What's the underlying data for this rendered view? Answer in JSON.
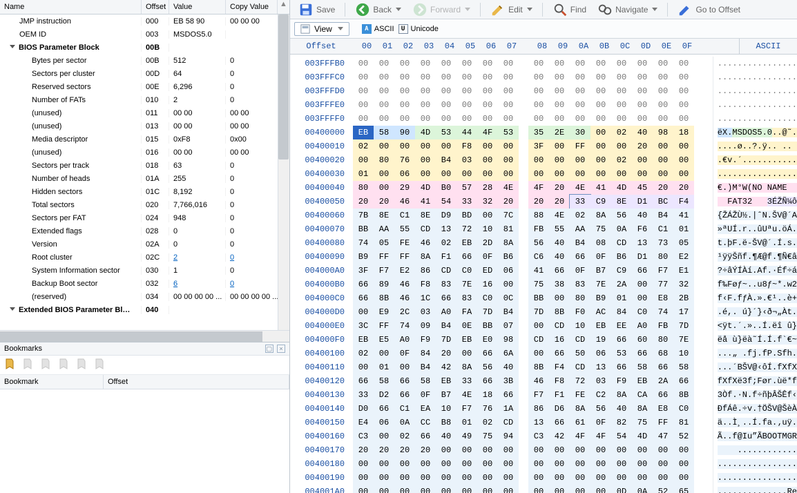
{
  "toolbar": {
    "save": "Save",
    "back": "Back",
    "forward": "Forward",
    "edit": "Edit",
    "find": "Find",
    "navigate": "Navigate",
    "goto": "Go to Offset"
  },
  "subbar": {
    "view": "View",
    "ascii": "ASCII",
    "unicode": "Unicode"
  },
  "tree_headers": {
    "name": "Name",
    "offset": "Offset",
    "value": "Value",
    "copy": "Copy Value"
  },
  "tree_scroll_arrow": "▲",
  "tree": [
    {
      "lvl": 1,
      "name": "JMP instruction",
      "off": "000",
      "val": "EB 58 90",
      "cv": "00 00 00"
    },
    {
      "lvl": 1,
      "name": "OEM ID",
      "off": "003",
      "val": "MSDOS5.0"
    },
    {
      "lvl": 0,
      "name": "BIOS Parameter Block",
      "off": "00B",
      "bold": true,
      "exp": true
    },
    {
      "lvl": 2,
      "name": "Bytes per sector",
      "off": "00B",
      "val": "512",
      "cv": "0"
    },
    {
      "lvl": 2,
      "name": "Sectors per cluster",
      "off": "00D",
      "val": "64",
      "cv": "0"
    },
    {
      "lvl": 2,
      "name": "Reserved sectors",
      "off": "00E",
      "val": "6,296",
      "cv": "0"
    },
    {
      "lvl": 2,
      "name": "Number of FATs",
      "off": "010",
      "val": "2",
      "cv": "0"
    },
    {
      "lvl": 2,
      "name": "(unused)",
      "off": "011",
      "val": "00 00",
      "cv": "00 00"
    },
    {
      "lvl": 2,
      "name": "(unused)",
      "off": "013",
      "val": "00 00",
      "cv": "00 00"
    },
    {
      "lvl": 2,
      "name": "Media descriptor",
      "off": "015",
      "val": "0xF8",
      "cv": "0x00"
    },
    {
      "lvl": 2,
      "name": "(unused)",
      "off": "016",
      "val": "00 00",
      "cv": "00 00"
    },
    {
      "lvl": 2,
      "name": "Sectors per track",
      "off": "018",
      "val": "63",
      "cv": "0"
    },
    {
      "lvl": 2,
      "name": "Number of heads",
      "off": "01A",
      "val": "255",
      "cv": "0"
    },
    {
      "lvl": 2,
      "name": "Hidden sectors",
      "off": "01C",
      "val": "8,192",
      "cv": "0"
    },
    {
      "lvl": 2,
      "name": "Total sectors",
      "off": "020",
      "val": "7,766,016",
      "cv": "0"
    },
    {
      "lvl": 2,
      "name": "Sectors per FAT",
      "off": "024",
      "val": "948",
      "cv": "0"
    },
    {
      "lvl": 2,
      "name": "Extended flags",
      "off": "028",
      "val": "0",
      "cv": "0"
    },
    {
      "lvl": 2,
      "name": "Version",
      "off": "02A",
      "val": "0",
      "cv": "0"
    },
    {
      "lvl": 2,
      "name": "Root cluster",
      "off": "02C",
      "val": "2",
      "cv": "0",
      "link": true
    },
    {
      "lvl": 2,
      "name": "System Information sector",
      "off": "030",
      "val": "1",
      "cv": "0"
    },
    {
      "lvl": 2,
      "name": "Backup Boot sector",
      "off": "032",
      "val": "6",
      "cv": "0",
      "link": true
    },
    {
      "lvl": 2,
      "name": "(reserved)",
      "off": "034",
      "val": "00 00 00 00 ...",
      "cv": "00 00 00 00 ..."
    },
    {
      "lvl": 0,
      "name": "Extended BIOS Parameter Bl…",
      "off": "040",
      "bold": true,
      "exp": true
    },
    {
      "lvl": 1,
      "name": "",
      "off": "",
      "val": "",
      "cv": ""
    }
  ],
  "bookmarks": {
    "title": "Bookmarks",
    "col_name": "Bookmark",
    "col_off": "Offset"
  },
  "hex_header": {
    "offset": "Offset",
    "cols": [
      "00",
      "01",
      "02",
      "03",
      "04",
      "05",
      "06",
      "07",
      "08",
      "09",
      "0A",
      "0B",
      "0C",
      "0D",
      "0E",
      "0F"
    ],
    "ascii": "ASCII"
  },
  "hex_rows": [
    {
      "off": "003FFFB0",
      "b": [
        "00",
        "00",
        "00",
        "00",
        "00",
        "00",
        "00",
        "00",
        "00",
        "00",
        "00",
        "00",
        "00",
        "00",
        "00",
        "00"
      ],
      "asc": "................",
      "hl": "gray"
    },
    {
      "off": "003FFFC0",
      "b": [
        "00",
        "00",
        "00",
        "00",
        "00",
        "00",
        "00",
        "00",
        "00",
        "00",
        "00",
        "00",
        "00",
        "00",
        "00",
        "00"
      ],
      "asc": "................",
      "hl": "gray"
    },
    {
      "off": "003FFFD0",
      "b": [
        "00",
        "00",
        "00",
        "00",
        "00",
        "00",
        "00",
        "00",
        "00",
        "00",
        "00",
        "00",
        "00",
        "00",
        "00",
        "00"
      ],
      "asc": "................",
      "hl": "gray"
    },
    {
      "off": "003FFFE0",
      "b": [
        "00",
        "00",
        "00",
        "00",
        "00",
        "00",
        "00",
        "00",
        "00",
        "00",
        "00",
        "00",
        "00",
        "00",
        "00",
        "00"
      ],
      "asc": "................",
      "hl": "gray"
    },
    {
      "off": "003FFFF0",
      "b": [
        "00",
        "00",
        "00",
        "00",
        "00",
        "00",
        "00",
        "00",
        "00",
        "00",
        "00",
        "00",
        "00",
        "00",
        "00",
        "00"
      ],
      "asc": "................",
      "hl": "gray"
    },
    {
      "off": "00400000",
      "b": [
        "EB",
        "58",
        "90",
        "4D",
        "53",
        "44",
        "4F",
        "53",
        "35",
        "2E",
        "30",
        "00",
        "02",
        "40",
        "98",
        "18"
      ],
      "asc": "ëX.MSDOS5.0..@˜.",
      "seg": [
        [
          "hl-blue",
          0,
          2
        ],
        [
          "hl-green",
          3,
          7
        ],
        [
          "hl-green",
          8,
          10
        ],
        [
          "hl-yellow",
          11,
          15
        ]
      ],
      "cursor": 0,
      "ascSeg": [
        [
          "hl-blue",
          0,
          2
        ],
        [
          "hl-green",
          3,
          10
        ],
        [
          "hl-yellow",
          11,
          15
        ]
      ]
    },
    {
      "off": "00400010",
      "b": [
        "02",
        "00",
        "00",
        "00",
        "00",
        "F8",
        "00",
        "00",
        "3F",
        "00",
        "FF",
        "00",
        "00",
        "20",
        "00",
        "00"
      ],
      "asc": "....ø..?.ÿ.. ..",
      "seg": [
        [
          "hl-yellow2",
          0,
          15
        ]
      ],
      "ascSeg": [
        [
          "hl-yellow2",
          0,
          15
        ]
      ]
    },
    {
      "off": "00400020",
      "b": [
        "00",
        "80",
        "76",
        "00",
        "B4",
        "03",
        "00",
        "00",
        "00",
        "00",
        "00",
        "00",
        "02",
        "00",
        "00",
        "00"
      ],
      "asc": ".€v.´...........",
      "seg": [
        [
          "hl-yellow2",
          0,
          15
        ]
      ],
      "ascSeg": [
        [
          "hl-yellow2",
          0,
          15
        ]
      ]
    },
    {
      "off": "00400030",
      "b": [
        "01",
        "00",
        "06",
        "00",
        "00",
        "00",
        "00",
        "00",
        "00",
        "00",
        "00",
        "00",
        "00",
        "00",
        "00",
        "00"
      ],
      "asc": "................",
      "seg": [
        [
          "hl-yellow2",
          0,
          15
        ]
      ],
      "ascSeg": [
        [
          "hl-yellow2",
          0,
          15
        ]
      ]
    },
    {
      "off": "00400040",
      "b": [
        "80",
        "00",
        "29",
        "4D",
        "B0",
        "57",
        "28",
        "4E",
        "4F",
        "20",
        "4E",
        "41",
        "4D",
        "45",
        "20",
        "20"
      ],
      "asc": "€.)M°W(NO NAME  ",
      "seg": [
        [
          "hl-pink",
          0,
          15
        ]
      ],
      "ascSeg": [
        [
          "hl-pink",
          0,
          15
        ]
      ]
    },
    {
      "off": "00400050",
      "b": [
        "20",
        "20",
        "46",
        "41",
        "54",
        "33",
        "32",
        "20",
        "20",
        "20",
        "33",
        "C9",
        "8E",
        "D1",
        "BC",
        "F4"
      ],
      "asc": "  FAT32   3ÉŽÑ¼ô",
      "seg": [
        [
          "hl-pink",
          0,
          9
        ],
        [
          "hl-lav",
          10,
          15
        ]
      ],
      "boxed": [
        10
      ],
      "ascSeg": [
        [
          "hl-pink",
          0,
          9
        ],
        [
          "hl-lav",
          10,
          15
        ]
      ]
    },
    {
      "off": "00400060",
      "b": [
        "7B",
        "8E",
        "C1",
        "8E",
        "D9",
        "BD",
        "00",
        "7C",
        "88",
        "4E",
        "02",
        "8A",
        "56",
        "40",
        "B4",
        "41"
      ],
      "asc": "{ŽÁŽÙ½.|ˆN.ŠV@´A",
      "hl": "hl-body"
    },
    {
      "off": "00400070",
      "b": [
        "BB",
        "AA",
        "55",
        "CD",
        "13",
        "72",
        "10",
        "81",
        "FB",
        "55",
        "AA",
        "75",
        "0A",
        "F6",
        "C1",
        "01"
      ],
      "asc": "»ªUÍ.r..ûUªu.öÁ.",
      "hl": "hl-body"
    },
    {
      "off": "00400080",
      "b": [
        "74",
        "05",
        "FE",
        "46",
        "02",
        "EB",
        "2D",
        "8A",
        "56",
        "40",
        "B4",
        "08",
        "CD",
        "13",
        "73",
        "05"
      ],
      "asc": "t.þF.ë-ŠV@´.Í.s.",
      "hl": "hl-body"
    },
    {
      "off": "00400090",
      "b": [
        "B9",
        "FF",
        "FF",
        "8A",
        "F1",
        "66",
        "0F",
        "B6",
        "C6",
        "40",
        "66",
        "0F",
        "B6",
        "D1",
        "80",
        "E2"
      ],
      "asc": "¹ÿÿŠñf.¶Æ@f.¶Ñ€â",
      "hl": "hl-body"
    },
    {
      "off": "004000A0",
      "b": [
        "3F",
        "F7",
        "E2",
        "86",
        "CD",
        "C0",
        "ED",
        "06",
        "41",
        "66",
        "0F",
        "B7",
        "C9",
        "66",
        "F7",
        "E1"
      ],
      "asc": "?÷âÝÍÀí.Af.·Éf÷á",
      "hl": "hl-body"
    },
    {
      "off": "004000B0",
      "b": [
        "66",
        "89",
        "46",
        "F8",
        "83",
        "7E",
        "16",
        "00",
        "75",
        "38",
        "83",
        "7E",
        "2A",
        "00",
        "77",
        "32"
      ],
      "asc": "f‰Føƒ~..u8ƒ~*.w2",
      "hl": "hl-body"
    },
    {
      "off": "004000C0",
      "b": [
        "66",
        "8B",
        "46",
        "1C",
        "66",
        "83",
        "C0",
        "0C",
        "BB",
        "00",
        "80",
        "B9",
        "01",
        "00",
        "E8",
        "2B"
      ],
      "asc": "f‹F.fƒÀ.».€¹..è+",
      "hl": "hl-body"
    },
    {
      "off": "004000D0",
      "b": [
        "00",
        "E9",
        "2C",
        "03",
        "A0",
        "FA",
        "7D",
        "B4",
        "7D",
        "8B",
        "F0",
        "AC",
        "84",
        "C0",
        "74",
        "17"
      ],
      "asc": ".é,. ú}´}‹ð¬„Àt.",
      "hl": "hl-body"
    },
    {
      "off": "004000E0",
      "b": [
        "3C",
        "FF",
        "74",
        "09",
        "B4",
        "0E",
        "BB",
        "07",
        "00",
        "CD",
        "10",
        "EB",
        "EE",
        "A0",
        "FB",
        "7D"
      ],
      "asc": "<ÿt.´.»..Í.ëî û}",
      "hl": "hl-body"
    },
    {
      "off": "004000F0",
      "b": [
        "EB",
        "E5",
        "A0",
        "F9",
        "7D",
        "EB",
        "E0",
        "98",
        "CD",
        "16",
        "CD",
        "19",
        "66",
        "60",
        "80",
        "7E"
      ],
      "asc": "ëå ù}ëà˜Í.Í.f`€~",
      "hl": "hl-body"
    },
    {
      "off": "00400100",
      "b": [
        "02",
        "00",
        "0F",
        "84",
        "20",
        "00",
        "66",
        "6A",
        "00",
        "66",
        "50",
        "06",
        "53",
        "66",
        "68",
        "10"
      ],
      "asc": "...„ .fj.fP.Sfh.",
      "hl": "hl-body"
    },
    {
      "off": "00400110",
      "b": [
        "00",
        "01",
        "00",
        "B4",
        "42",
        "8A",
        "56",
        "40",
        "8B",
        "F4",
        "CD",
        "13",
        "66",
        "58",
        "66",
        "58"
      ],
      "asc": "...´BŠV@‹ôÍ.fXfX",
      "hl": "hl-body"
    },
    {
      "off": "00400120",
      "b": [
        "66",
        "58",
        "66",
        "58",
        "EB",
        "33",
        "66",
        "3B",
        "46",
        "F8",
        "72",
        "03",
        "F9",
        "EB",
        "2A",
        "66"
      ],
      "asc": "fXfXë3f;Før.ùë*f",
      "hl": "hl-body"
    },
    {
      "off": "00400130",
      "b": [
        "33",
        "D2",
        "66",
        "0F",
        "B7",
        "4E",
        "18",
        "66",
        "F7",
        "F1",
        "FE",
        "C2",
        "8A",
        "CA",
        "66",
        "8B"
      ],
      "asc": "3Òf.·N.f÷ñþÂŠÊf‹",
      "hl": "hl-body"
    },
    {
      "off": "00400140",
      "b": [
        "D0",
        "66",
        "C1",
        "EA",
        "10",
        "F7",
        "76",
        "1A",
        "86",
        "D6",
        "8A",
        "56",
        "40",
        "8A",
        "E8",
        "C0"
      ],
      "asc": "ÐfÁê.÷v.†ÖŠV@ŠèÀ",
      "hl": "hl-body"
    },
    {
      "off": "00400150",
      "b": [
        "E4",
        "06",
        "0A",
        "CC",
        "B8",
        "01",
        "02",
        "CD",
        "13",
        "66",
        "61",
        "0F",
        "82",
        "75",
        "FF",
        "81"
      ],
      "asc": "ä..Ì¸..Í.fa.‚uÿ.",
      "hl": "hl-body"
    },
    {
      "off": "00400160",
      "b": [
        "C3",
        "00",
        "02",
        "66",
        "40",
        "49",
        "75",
        "94",
        "C3",
        "42",
        "4F",
        "4F",
        "54",
        "4D",
        "47",
        "52"
      ],
      "asc": "Ã..f@Iu”ÃBOOTMGR",
      "hl": "hl-body"
    },
    {
      "off": "00400170",
      "b": [
        "20",
        "20",
        "20",
        "20",
        "00",
        "00",
        "00",
        "00",
        "00",
        "00",
        "00",
        "00",
        "00",
        "00",
        "00",
        "00"
      ],
      "asc": "    ............",
      "hl": "hl-body"
    },
    {
      "off": "00400180",
      "b": [
        "00",
        "00",
        "00",
        "00",
        "00",
        "00",
        "00",
        "00",
        "00",
        "00",
        "00",
        "00",
        "00",
        "00",
        "00",
        "00"
      ],
      "asc": "................",
      "hl": "hl-body"
    },
    {
      "off": "00400190",
      "b": [
        "00",
        "00",
        "00",
        "00",
        "00",
        "00",
        "00",
        "00",
        "00",
        "00",
        "00",
        "00",
        "00",
        "00",
        "00",
        "00"
      ],
      "asc": "................",
      "hl": "hl-body"
    },
    {
      "off": "004001A0",
      "b": [
        "00",
        "00",
        "00",
        "00",
        "00",
        "00",
        "00",
        "00",
        "00",
        "00",
        "00",
        "00",
        "0D",
        "0A",
        "52",
        "65"
      ],
      "asc": "..............Re",
      "hl": "hl-body"
    }
  ]
}
